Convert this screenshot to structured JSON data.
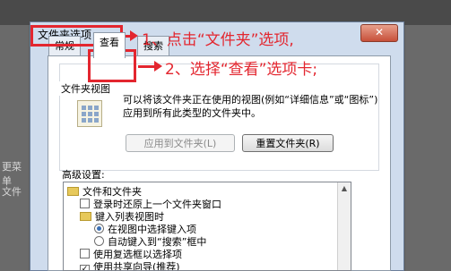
{
  "background": {
    "left_fragment_1": "更菜单",
    "left_fragment_2": "文件"
  },
  "dialog": {
    "title": "文件夹选项",
    "close_glyph": "✕",
    "tabs": [
      {
        "label": "常规"
      },
      {
        "label": "查看"
      },
      {
        "label": "搜索"
      }
    ],
    "folder_views": {
      "group_label": "文件夹视图",
      "description": "可以将该文件夹正在使用的视图(例如“详细信息”或“图标”)应用到所有此类型的文件夹中。",
      "apply_button": "应用到文件夹(L)",
      "reset_button": "重置文件夹(R)"
    },
    "advanced": {
      "label": "高级设置:",
      "rows": [
        {
          "kind": "folder",
          "label": "文件和文件夹"
        },
        {
          "kind": "checkbox",
          "label": "登录时还原上一个文件夹窗口",
          "checked": false
        },
        {
          "kind": "folder",
          "label": "键入列表视图时"
        },
        {
          "kind": "radio",
          "label": "在视图中选择键入项",
          "checked": true
        },
        {
          "kind": "radio",
          "label": "自动键入到“搜索”框中",
          "checked": false
        },
        {
          "kind": "checkbox",
          "label": "使用复选框以选择项",
          "checked": false
        },
        {
          "kind": "checkbox",
          "label": "使用共享向导(推荐)",
          "checked": true
        }
      ]
    }
  },
  "annotations": {
    "step1": "1、点击“文件夹”选项,",
    "step2": "2、选择“查看”选项卡;"
  },
  "colors": {
    "annotation_red": "#e3262f",
    "dialog_bg": "#cfdced"
  }
}
